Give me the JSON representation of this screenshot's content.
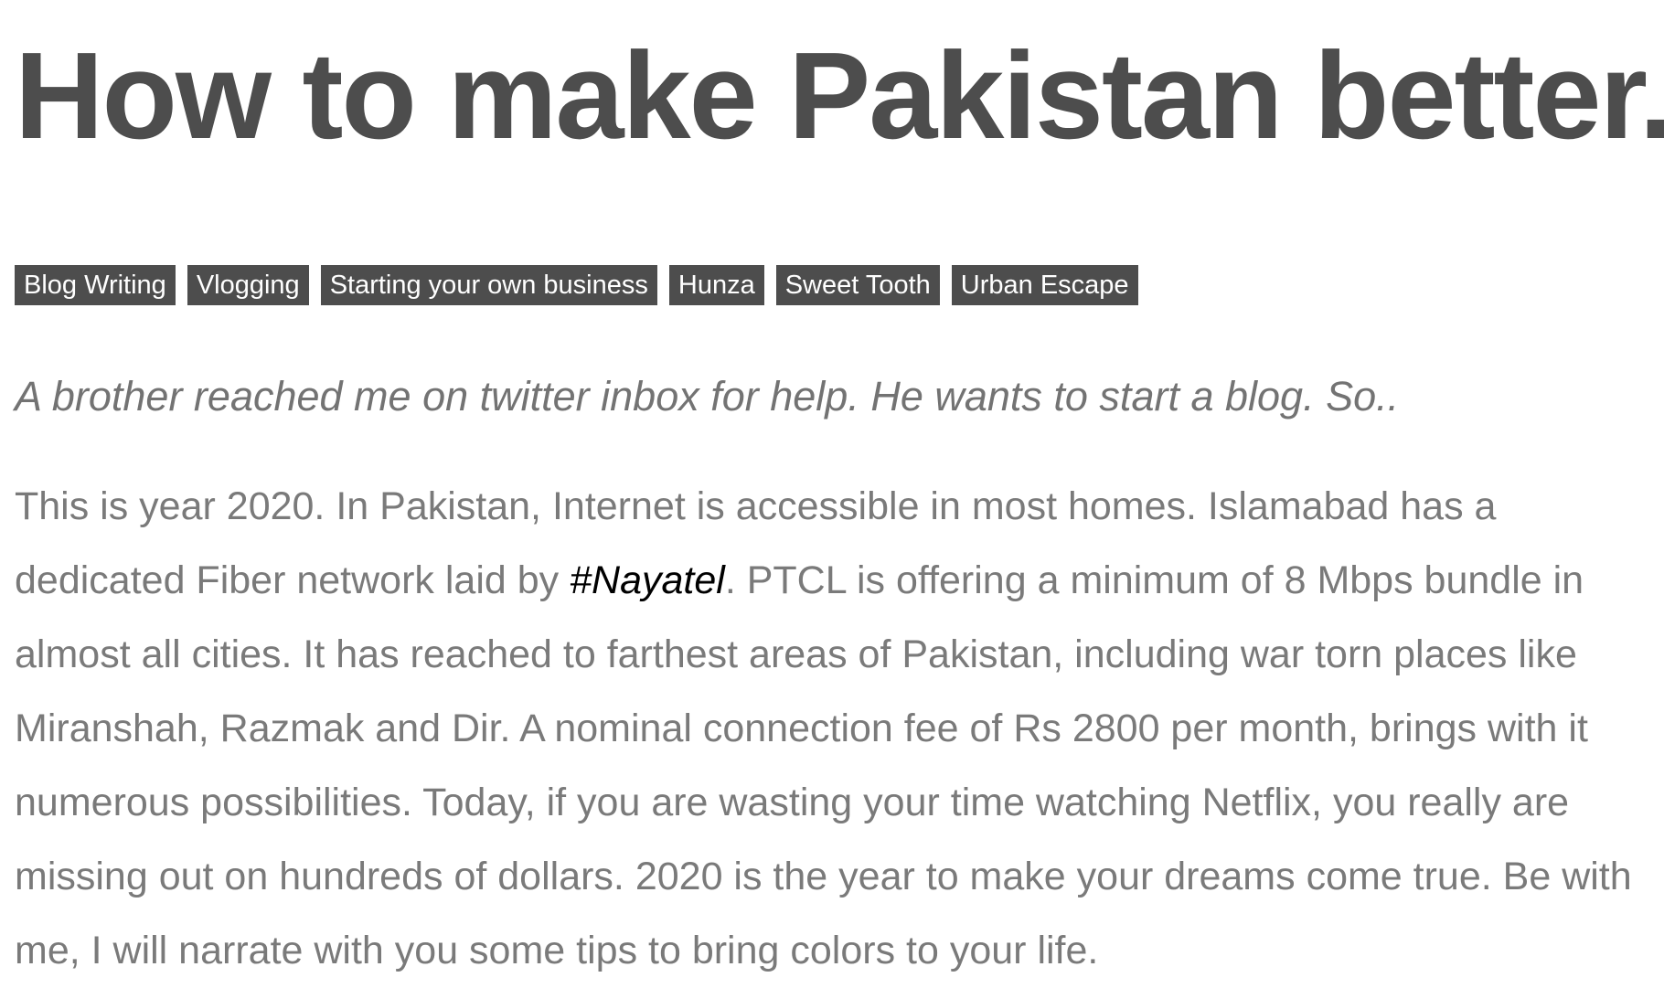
{
  "article": {
    "title": "How to make Pakistan better.",
    "tags": [
      "Blog Writing",
      "Vlogging",
      "Starting your own business",
      "Hunza",
      "Sweet Tooth",
      "Urban Escape"
    ],
    "excerpt": "A brother reached me on twitter inbox for help. He wants to start a blog. So..",
    "body": {
      "before_link": "This is year 2020. In Pakistan, Internet is accessible in most homes. Islamabad has a dedicated Fiber network laid by ",
      "link_text": "#Nayatel",
      "after_link": ". PTCL is offering a minimum of 8 Mbps bundle in almost all cities. It has reached to farthest areas of Pakistan, including war torn places like Miranshah, Razmak and Dir. A nominal connection fee of Rs 2800 per month, brings with it numerous possibilities. Today, if you are wasting your time watching Netflix, you really are missing out on hundreds of dollars. 2020 is the year to make your dreams come true. Be with me, I will narrate with you some tips to bring colors to your life."
    }
  },
  "colors": {
    "title": "#4d4d4d",
    "tag_background": "#4d4d4d",
    "tag_text": "#ffffff",
    "excerpt": "#737373",
    "body": "#7a7a7a",
    "hashtag": "#000000"
  }
}
